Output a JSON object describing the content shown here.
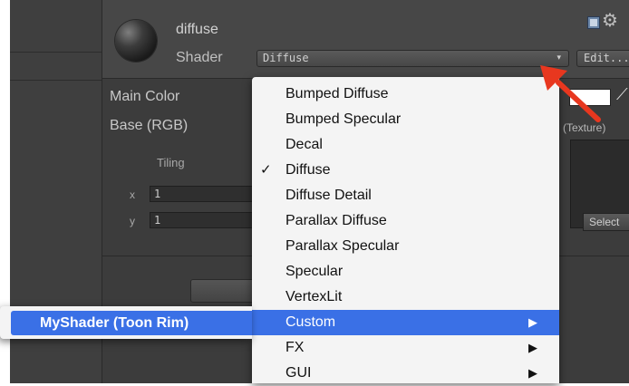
{
  "material": {
    "name": "diffuse",
    "shader_label": "Shader",
    "shader_value": "Diffuse",
    "edit_button": "Edit..."
  },
  "properties": {
    "main_color_label": "Main Color",
    "base_label": "Base (RGB)",
    "tiling_label": "Tiling",
    "x_label": "x",
    "y_label": "y",
    "tiling_x": "1",
    "tiling_y": "1",
    "texture_label": "(Texture)",
    "select_button": "Select",
    "swatch_color": "#ffffff"
  },
  "menu": {
    "items": [
      {
        "label": "Bumped Diffuse",
        "checked": false,
        "submenu": false
      },
      {
        "label": "Bumped Specular",
        "checked": false,
        "submenu": false
      },
      {
        "label": "Decal",
        "checked": false,
        "submenu": false
      },
      {
        "label": "Diffuse",
        "checked": true,
        "submenu": false
      },
      {
        "label": "Diffuse Detail",
        "checked": false,
        "submenu": false
      },
      {
        "label": "Parallax Diffuse",
        "checked": false,
        "submenu": false
      },
      {
        "label": "Parallax Specular",
        "checked": false,
        "submenu": false
      },
      {
        "label": "Specular",
        "checked": false,
        "submenu": false
      },
      {
        "label": "VertexLit",
        "checked": false,
        "submenu": false
      },
      {
        "label": "Custom",
        "checked": false,
        "submenu": true,
        "highlighted": true
      },
      {
        "label": "FX",
        "checked": false,
        "submenu": true
      },
      {
        "label": "GUI",
        "checked": false,
        "submenu": true
      }
    ],
    "check_glyph": "✓",
    "arrow_glyph": "▶",
    "highlight_color": "#3a70e6"
  },
  "submenu": {
    "item_label": "MyShader (Toon Rim)"
  },
  "icons": {
    "gear": "⚙",
    "eyedropper": "⟋",
    "dropdown_arrow": "▾"
  },
  "annotation": {
    "arrow_color": "#e8371f"
  }
}
